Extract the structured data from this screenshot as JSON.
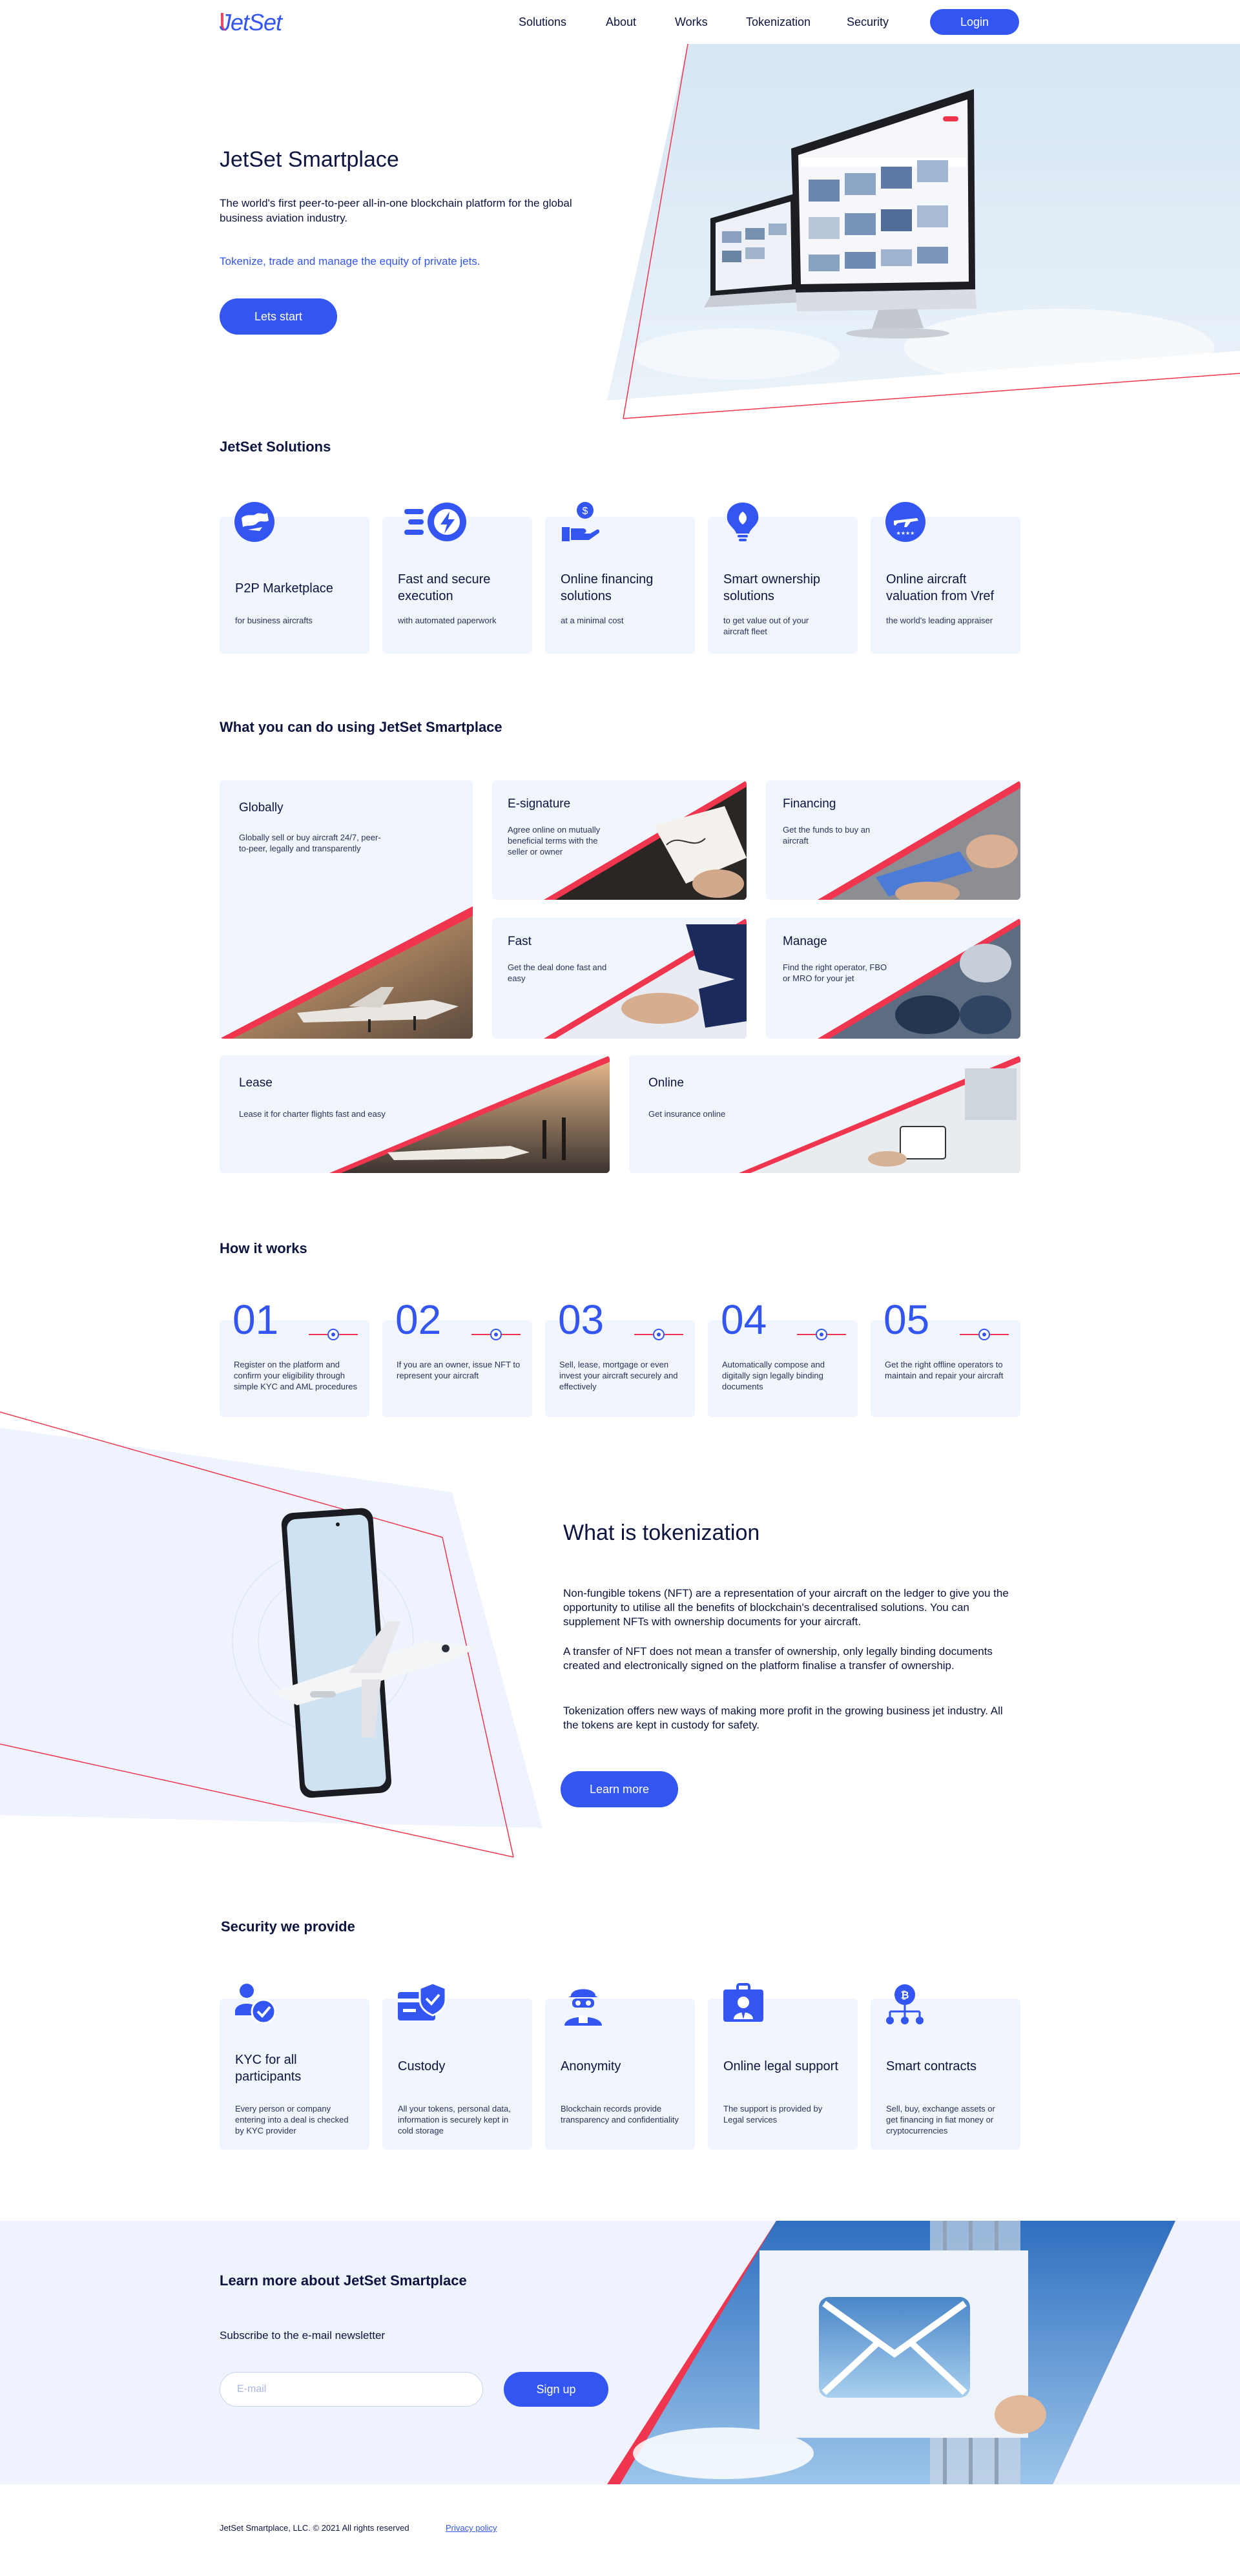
{
  "header": {
    "logo": "JetSet",
    "nav": [
      "Solutions",
      "About",
      "Works",
      "Tokenization",
      "Security"
    ],
    "login_label": "Login"
  },
  "hero": {
    "title": "JetSet Smartplace",
    "description": "The world's first peer-to-peer all-in-one blockchain platform for the global business aviation industry.",
    "tagline": "Tokenize, trade and manage the equity of private jets.",
    "cta_label": "Lets start"
  },
  "solutions": {
    "heading": "JetSet Solutions",
    "items": [
      {
        "icon": "globe-plane-icon",
        "title": "P2P Marketplace",
        "subtitle": "for business aircrafts"
      },
      {
        "icon": "fast-lightning-icon",
        "title": "Fast and secure execution",
        "subtitle": "with automated paperwork"
      },
      {
        "icon": "hand-dollar-icon",
        "title": "Online financing solutions",
        "subtitle": "at a minimal cost"
      },
      {
        "icon": "lightbulb-icon",
        "title": "Smart ownership solutions",
        "subtitle": "to get value out of your aircraft fleet"
      },
      {
        "icon": "plane-stars-icon",
        "title": "Online aircraft valuation from Vref",
        "subtitle": "the world's leading appraiser"
      }
    ]
  },
  "what_you_can_do": {
    "heading": "What you can do using JetSet Smartplace",
    "items": [
      {
        "title": "Globally",
        "subtitle": "Globally sell or buy aircraft 24/7, peer-to-peer, legally and transparently"
      },
      {
        "title": "E-signature",
        "subtitle": "Agree online on mutually beneficial terms with the seller or owner"
      },
      {
        "title": "Financing",
        "subtitle": "Get the funds to buy an aircraft"
      },
      {
        "title": "Fast",
        "subtitle": "Get the deal done fast and easy"
      },
      {
        "title": "Manage",
        "subtitle": "Find the right operator, FBO or MRO for your jet"
      },
      {
        "title": "Lease",
        "subtitle": "Lease it for charter flights fast and easy"
      },
      {
        "title": "Online",
        "subtitle": "Get insurance online"
      }
    ]
  },
  "how_it_works": {
    "heading": "How it works",
    "steps": [
      {
        "number": "01",
        "text": "Register on the platform and confirm your eligibility through simple KYC and AML procedures"
      },
      {
        "number": "02",
        "text": "If you are an owner, issue NFT to represent your aircraft"
      },
      {
        "number": "03",
        "text": "Sell, lease, mortgage or even invest your aircraft securely and effectively"
      },
      {
        "number": "04",
        "text": "Automatically compose and digitally sign legally binding documents"
      },
      {
        "number": "05",
        "text": "Get the right offline operators to maintain and repair your aircraft"
      }
    ]
  },
  "tokenization": {
    "heading": "What is tokenization",
    "paragraphs": [
      "Non-fungible tokens (NFT) are a representation of your aircraft on the ledger to give you the opportunity to utilise all the benefits of blockchain's decentralised solutions. You can supplement NFTs with ownership documents for your aircraft.",
      "A transfer of NFT does not mean a transfer of ownership, only legally binding documents created and electronically signed on the platform finalise a transfer of ownership.",
      "Tokenization offers new ways of making more profit in the growing business jet industry. All the tokens are kept in custody for safety."
    ],
    "cta_label": "Learn more"
  },
  "security": {
    "heading": "Security we provide",
    "items": [
      {
        "icon": "user-check-icon",
        "title": "KYC for all participants",
        "subtitle": "Every person or company entering into a deal is checked by KYC provider"
      },
      {
        "icon": "card-shield-icon",
        "title": "Custody",
        "subtitle": "All your tokens, personal data, information is securely kept in cold storage"
      },
      {
        "icon": "anonymous-user-icon",
        "title": "Anonymity",
        "subtitle": "Blockchain records provide transparency and confidentiality"
      },
      {
        "icon": "legal-support-icon",
        "title": "Online legal support",
        "subtitle": "The support is provided by Legal services"
      },
      {
        "icon": "smart-contract-icon",
        "title": "Smart contracts",
        "subtitle": "Sell, buy, exchange assets or get financing in fiat money or cryptocurrencies"
      }
    ]
  },
  "newsletter": {
    "heading": "Learn more about JetSet Smartplace",
    "subheading": "Subscribe to the e-mail newsletter",
    "email_placeholder": "E-mail",
    "signup_label": "Sign up"
  },
  "footer": {
    "copyright": "JetSet Smartplace, LLC. © 2021 All rights reserved",
    "privacy": "Privacy policy"
  },
  "colors": {
    "accent": "#3355f2",
    "navy": "#0d1440",
    "red": "#f0354e",
    "light_bg": "#f1f5fe"
  }
}
